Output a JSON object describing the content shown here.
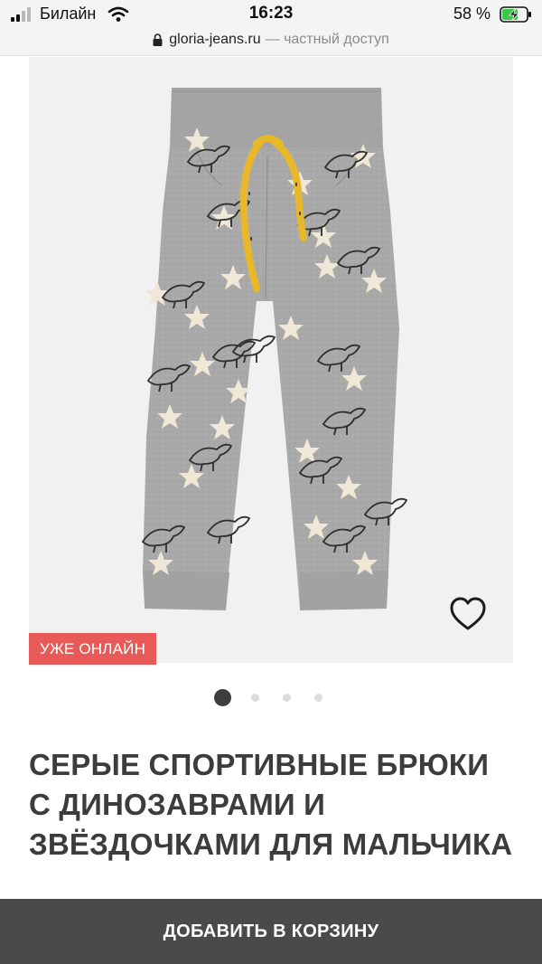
{
  "status_bar": {
    "carrier": "Билайн",
    "time": "16:23",
    "battery": "58 %"
  },
  "url_bar": {
    "host": "gloria-jeans.ru",
    "suffix": "— частный доступ"
  },
  "product": {
    "badge": "УЖЕ ОНЛАЙН",
    "title": "СЕРЫЕ СПОРТИВНЫЕ БРЮКИ С ДИНОЗАВРАМИ И ЗВЁЗДОЧКАМИ ДЛЯ МАЛЬЧИКА",
    "image_description_icon": "pants-image",
    "wishlist_icon": "heart-outline-icon"
  },
  "carousel": {
    "total_slides": 4,
    "active_slide": 1
  },
  "actions": {
    "add_to_cart": "ДОБАВИТЬ В КОРЗИНУ"
  },
  "colors": {
    "badge": "#e85a58",
    "button": "#4a4a4a",
    "pants": "#a8a8a8",
    "drawstring": "#e8b82a"
  }
}
